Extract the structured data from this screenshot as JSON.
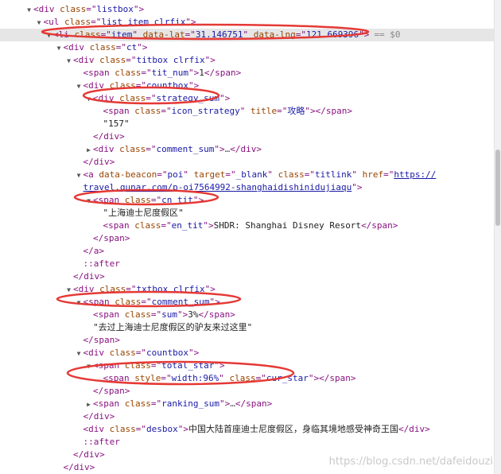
{
  "lines": [
    {
      "indent": 2,
      "tri": "open",
      "parts": [
        {
          "c": "tag",
          "t": "<div "
        },
        {
          "c": "attr",
          "t": "class"
        },
        {
          "c": "tag",
          "t": "=\""
        },
        {
          "c": "val",
          "t": "listbox"
        },
        {
          "c": "tag",
          "t": "\">"
        }
      ]
    },
    {
      "indent": 3,
      "tri": "open",
      "parts": [
        {
          "c": "tag",
          "t": "<ul "
        },
        {
          "c": "attr",
          "t": "class"
        },
        {
          "c": "tag",
          "t": "=\""
        },
        {
          "c": "val",
          "t": "list_item clrfix"
        },
        {
          "c": "tag",
          "t": "\">"
        }
      ]
    },
    {
      "indent": 4,
      "tri": "open",
      "selected": true,
      "parts": [
        {
          "c": "tag",
          "t": "<li "
        },
        {
          "c": "attr",
          "t": "class"
        },
        {
          "c": "tag",
          "t": "=\""
        },
        {
          "c": "val",
          "t": "item"
        },
        {
          "c": "tag",
          "t": "\" "
        },
        {
          "c": "attr",
          "t": "data-lat"
        },
        {
          "c": "tag",
          "t": "=\""
        },
        {
          "c": "val",
          "t": "31.146751"
        },
        {
          "c": "tag",
          "t": "\" "
        },
        {
          "c": "attr",
          "t": "data-lng"
        },
        {
          "c": "tag",
          "t": "=\""
        },
        {
          "c": "val",
          "t": "121.669396"
        },
        {
          "c": "tag",
          "t": "\">"
        },
        {
          "c": "dollar",
          "t": "== $0"
        }
      ]
    },
    {
      "indent": 5,
      "tri": "open",
      "parts": [
        {
          "c": "tag",
          "t": "<div "
        },
        {
          "c": "attr",
          "t": "class"
        },
        {
          "c": "tag",
          "t": "=\""
        },
        {
          "c": "val",
          "t": "ct"
        },
        {
          "c": "tag",
          "t": "\">"
        }
      ]
    },
    {
      "indent": 6,
      "tri": "open",
      "parts": [
        {
          "c": "tag",
          "t": "<div "
        },
        {
          "c": "attr",
          "t": "class"
        },
        {
          "c": "tag",
          "t": "=\""
        },
        {
          "c": "val",
          "t": "titbox clrfix"
        },
        {
          "c": "tag",
          "t": "\">"
        }
      ]
    },
    {
      "indent": 7,
      "tri": "none",
      "parts": [
        {
          "c": "tag",
          "t": "<span "
        },
        {
          "c": "attr",
          "t": "class"
        },
        {
          "c": "tag",
          "t": "=\""
        },
        {
          "c": "val",
          "t": "tit_num"
        },
        {
          "c": "tag",
          "t": "\">"
        },
        {
          "c": "txt",
          "t": "1"
        },
        {
          "c": "tag",
          "t": "</span>"
        }
      ]
    },
    {
      "indent": 7,
      "tri": "open",
      "parts": [
        {
          "c": "tag",
          "t": "<div "
        },
        {
          "c": "attr",
          "t": "class"
        },
        {
          "c": "tag",
          "t": "=\""
        },
        {
          "c": "val",
          "t": "countbox"
        },
        {
          "c": "tag",
          "t": "\">"
        }
      ]
    },
    {
      "indent": 8,
      "tri": "open",
      "parts": [
        {
          "c": "tag",
          "t": "<div "
        },
        {
          "c": "attr",
          "t": "class"
        },
        {
          "c": "tag",
          "t": "=\""
        },
        {
          "c": "val",
          "t": "strategy_sum"
        },
        {
          "c": "tag",
          "t": "\">"
        }
      ]
    },
    {
      "indent": 9,
      "tri": "none",
      "parts": [
        {
          "c": "tag",
          "t": "<span "
        },
        {
          "c": "attr",
          "t": "class"
        },
        {
          "c": "tag",
          "t": "=\""
        },
        {
          "c": "val",
          "t": "icon_strategy"
        },
        {
          "c": "tag",
          "t": "\" "
        },
        {
          "c": "attr",
          "t": "title"
        },
        {
          "c": "tag",
          "t": "=\""
        },
        {
          "c": "val",
          "t": "攻略"
        },
        {
          "c": "tag",
          "t": "\"></span>"
        }
      ]
    },
    {
      "indent": 9,
      "tri": "none",
      "parts": [
        {
          "c": "txt",
          "t": "\"157\""
        }
      ]
    },
    {
      "indent": 8,
      "tri": "none",
      "parts": [
        {
          "c": "tag",
          "t": "</div>"
        }
      ]
    },
    {
      "indent": 8,
      "tri": "closed",
      "parts": [
        {
          "c": "tag",
          "t": "<div "
        },
        {
          "c": "attr",
          "t": "class"
        },
        {
          "c": "tag",
          "t": "=\""
        },
        {
          "c": "val",
          "t": "comment_sum"
        },
        {
          "c": "tag",
          "t": "\">"
        },
        {
          "c": "ell",
          "t": "…"
        },
        {
          "c": "tag",
          "t": "</div>"
        }
      ]
    },
    {
      "indent": 7,
      "tri": "none",
      "parts": [
        {
          "c": "tag",
          "t": "</div>"
        }
      ]
    },
    {
      "indent": 7,
      "tri": "open",
      "parts": [
        {
          "c": "tag",
          "t": "<a "
        },
        {
          "c": "attr",
          "t": "data-beacon"
        },
        {
          "c": "tag",
          "t": "=\""
        },
        {
          "c": "val",
          "t": "poi"
        },
        {
          "c": "tag",
          "t": "\" "
        },
        {
          "c": "attr",
          "t": "target"
        },
        {
          "c": "tag",
          "t": "=\""
        },
        {
          "c": "val",
          "t": "_blank"
        },
        {
          "c": "tag",
          "t": "\" "
        },
        {
          "c": "attr",
          "t": "class"
        },
        {
          "c": "tag",
          "t": "=\""
        },
        {
          "c": "val",
          "t": "titlink"
        },
        {
          "c": "tag",
          "t": "\" "
        },
        {
          "c": "attr",
          "t": "href"
        },
        {
          "c": "tag",
          "t": "=\""
        },
        {
          "c": "link",
          "t": "https://"
        }
      ]
    },
    {
      "indent": 7,
      "tri": "none",
      "parts": [
        {
          "c": "link",
          "t": "travel.qunar.com/p-oi7564992-shanghaidishinidujiaqu"
        },
        {
          "c": "tag",
          "t": "\">"
        }
      ]
    },
    {
      "indent": 8,
      "tri": "open",
      "parts": [
        {
          "c": "tag",
          "t": "<span "
        },
        {
          "c": "attr",
          "t": "class"
        },
        {
          "c": "tag",
          "t": "=\""
        },
        {
          "c": "val",
          "t": "cn_tit"
        },
        {
          "c": "tag",
          "t": "\">"
        }
      ]
    },
    {
      "indent": 9,
      "tri": "none",
      "parts": [
        {
          "c": "txt",
          "t": "\"上海迪士尼度假区\""
        }
      ]
    },
    {
      "indent": 9,
      "tri": "none",
      "parts": [
        {
          "c": "tag",
          "t": "<span "
        },
        {
          "c": "attr",
          "t": "class"
        },
        {
          "c": "tag",
          "t": "=\""
        },
        {
          "c": "val",
          "t": "en_tit"
        },
        {
          "c": "tag",
          "t": "\">"
        },
        {
          "c": "txt",
          "t": "SHDR: Shanghai Disney Resort"
        },
        {
          "c": "tag",
          "t": "</span>"
        }
      ]
    },
    {
      "indent": 8,
      "tri": "none",
      "parts": [
        {
          "c": "tag",
          "t": "</span>"
        }
      ]
    },
    {
      "indent": 7,
      "tri": "none",
      "parts": [
        {
          "c": "tag",
          "t": "</a>"
        }
      ]
    },
    {
      "indent": 7,
      "tri": "none",
      "parts": [
        {
          "c": "pseudo",
          "t": "::after"
        }
      ]
    },
    {
      "indent": 6,
      "tri": "none",
      "parts": [
        {
          "c": "tag",
          "t": "</div>"
        }
      ]
    },
    {
      "indent": 6,
      "tri": "open",
      "parts": [
        {
          "c": "tag",
          "t": "<div "
        },
        {
          "c": "attr",
          "t": "class"
        },
        {
          "c": "tag",
          "t": "=\""
        },
        {
          "c": "val",
          "t": "txtbox clrfix"
        },
        {
          "c": "tag",
          "t": "\">"
        }
      ]
    },
    {
      "indent": 7,
      "tri": "open",
      "parts": [
        {
          "c": "tag",
          "t": "<span "
        },
        {
          "c": "attr",
          "t": "class"
        },
        {
          "c": "tag",
          "t": "=\""
        },
        {
          "c": "val",
          "t": "comment_sum"
        },
        {
          "c": "tag",
          "t": "\">"
        }
      ]
    },
    {
      "indent": 8,
      "tri": "none",
      "parts": [
        {
          "c": "tag",
          "t": "<span "
        },
        {
          "c": "attr",
          "t": "class"
        },
        {
          "c": "tag",
          "t": "=\""
        },
        {
          "c": "val",
          "t": "sum"
        },
        {
          "c": "tag",
          "t": "\">"
        },
        {
          "c": "txt",
          "t": "3%"
        },
        {
          "c": "tag",
          "t": "</span>"
        }
      ]
    },
    {
      "indent": 8,
      "tri": "none",
      "parts": [
        {
          "c": "txt",
          "t": "\"去过上海迪士尼度假区的驴友来过这里\""
        }
      ]
    },
    {
      "indent": 7,
      "tri": "none",
      "parts": [
        {
          "c": "tag",
          "t": "</span>"
        }
      ]
    },
    {
      "indent": 7,
      "tri": "open",
      "parts": [
        {
          "c": "tag",
          "t": "<div "
        },
        {
          "c": "attr",
          "t": "class"
        },
        {
          "c": "tag",
          "t": "=\""
        },
        {
          "c": "val",
          "t": "countbox"
        },
        {
          "c": "tag",
          "t": "\">"
        }
      ]
    },
    {
      "indent": 8,
      "tri": "open",
      "parts": [
        {
          "c": "tag",
          "t": "<span "
        },
        {
          "c": "attr",
          "t": "class"
        },
        {
          "c": "tag",
          "t": "=\""
        },
        {
          "c": "val",
          "t": "total_star"
        },
        {
          "c": "tag",
          "t": "\">"
        }
      ]
    },
    {
      "indent": 9,
      "tri": "none",
      "parts": [
        {
          "c": "tag",
          "t": "<span "
        },
        {
          "c": "attr",
          "t": "style"
        },
        {
          "c": "tag",
          "t": "=\""
        },
        {
          "c": "val",
          "t": "width:96%"
        },
        {
          "c": "tag",
          "t": "\" "
        },
        {
          "c": "attr",
          "t": "class"
        },
        {
          "c": "tag",
          "t": "=\""
        },
        {
          "c": "val",
          "t": "cur_star"
        },
        {
          "c": "tag",
          "t": "\"></span>"
        }
      ]
    },
    {
      "indent": 8,
      "tri": "none",
      "parts": [
        {
          "c": "tag",
          "t": "</span>"
        }
      ]
    },
    {
      "indent": 8,
      "tri": "closed",
      "parts": [
        {
          "c": "tag",
          "t": "<span "
        },
        {
          "c": "attr",
          "t": "class"
        },
        {
          "c": "tag",
          "t": "=\""
        },
        {
          "c": "val",
          "t": "ranking_sum"
        },
        {
          "c": "tag",
          "t": "\">"
        },
        {
          "c": "ell",
          "t": "…"
        },
        {
          "c": "tag",
          "t": "</span>"
        }
      ]
    },
    {
      "indent": 7,
      "tri": "none",
      "parts": [
        {
          "c": "tag",
          "t": "</div>"
        }
      ]
    },
    {
      "indent": 7,
      "tri": "none",
      "parts": [
        {
          "c": "tag",
          "t": "<div "
        },
        {
          "c": "attr",
          "t": "class"
        },
        {
          "c": "tag",
          "t": "=\""
        },
        {
          "c": "val",
          "t": "desbox"
        },
        {
          "c": "tag",
          "t": "\">"
        },
        {
          "c": "txt",
          "t": "中国大陆首座迪士尼度假区，身临其境地感受神奇王国"
        },
        {
          "c": "tag",
          "t": "</div>"
        }
      ]
    },
    {
      "indent": 7,
      "tri": "none",
      "parts": [
        {
          "c": "pseudo",
          "t": "::after"
        }
      ]
    },
    {
      "indent": 6,
      "tri": "none",
      "parts": [
        {
          "c": "tag",
          "t": "</div>"
        }
      ]
    },
    {
      "indent": 5,
      "tri": "none",
      "parts": [
        {
          "c": "tag",
          "t": "</div>"
        }
      ]
    }
  ],
  "watermark": "https://blog.csdn.net/dafeidouzi",
  "colors": {
    "tag": "#881280",
    "attr": "#994500",
    "value": "#1a1aa6",
    "selection": "#e6e6e6",
    "annotation": "#e53935"
  }
}
